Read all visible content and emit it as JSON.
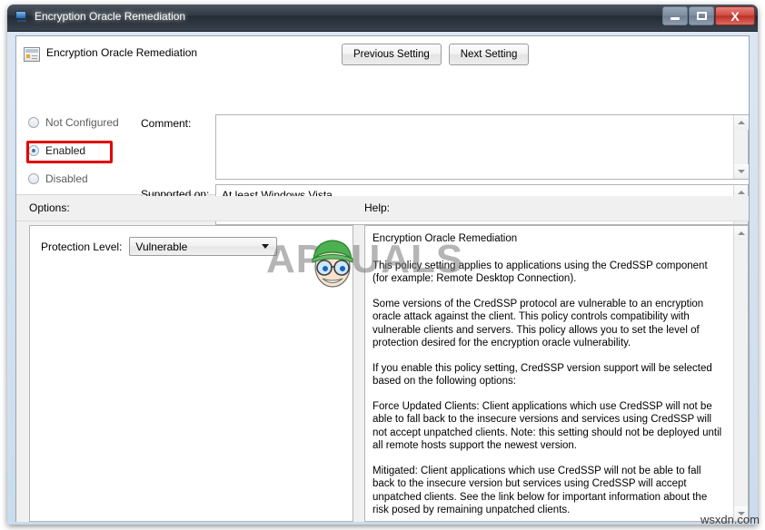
{
  "window": {
    "title": "Encryption Oracle Remediation",
    "icon": "computer-monitor-icon",
    "controls": {
      "minimize": "–",
      "maximize": "□",
      "close": "X"
    }
  },
  "header": {
    "title": "Encryption Oracle Remediation",
    "icon": "policy-setting-icon",
    "previous_button": "Previous Setting",
    "next_button": "Next Setting"
  },
  "state": {
    "options": [
      {
        "label": "Not Configured",
        "selected": false
      },
      {
        "label": "Enabled",
        "selected": true
      },
      {
        "label": "Disabled",
        "selected": false
      }
    ],
    "selected": "Enabled",
    "highlight_color": "#e20000"
  },
  "fields": {
    "comment_label": "Comment:",
    "comment_value": "",
    "supported_label": "Supported on:",
    "supported_value": "At least Windows Vista"
  },
  "sections": {
    "options_label": "Options:",
    "help_label": "Help:"
  },
  "options_panel": {
    "protection_label": "Protection Level:",
    "protection_value": "Vulnerable"
  },
  "help": {
    "title": "Encryption Oracle Remediation",
    "paragraphs": [
      "This policy setting applies to applications using the CredSSP component (for example: Remote Desktop Connection).",
      "Some versions of the CredSSP protocol are vulnerable to an encryption oracle attack against the client.  This policy controls compatibility with vulnerable clients and servers.  This policy allows you to set the level of protection desired for the encryption oracle vulnerability.",
      "If you enable this policy setting, CredSSP version support will be selected based on the following options:",
      "Force Updated Clients: Client applications which use CredSSP will not be able to fall back to the insecure versions and services using CredSSP will not accept unpatched clients. Note: this setting should not be deployed until all remote hosts support the newest version.",
      "Mitigated: Client applications which use CredSSP will not be able to fall back to the insecure version but services using CredSSP will accept unpatched clients. See the link below for important information about the risk posed by remaining unpatched clients."
    ]
  },
  "watermarks": {
    "brand": "APPUALS",
    "site": "wsxdn.com"
  }
}
